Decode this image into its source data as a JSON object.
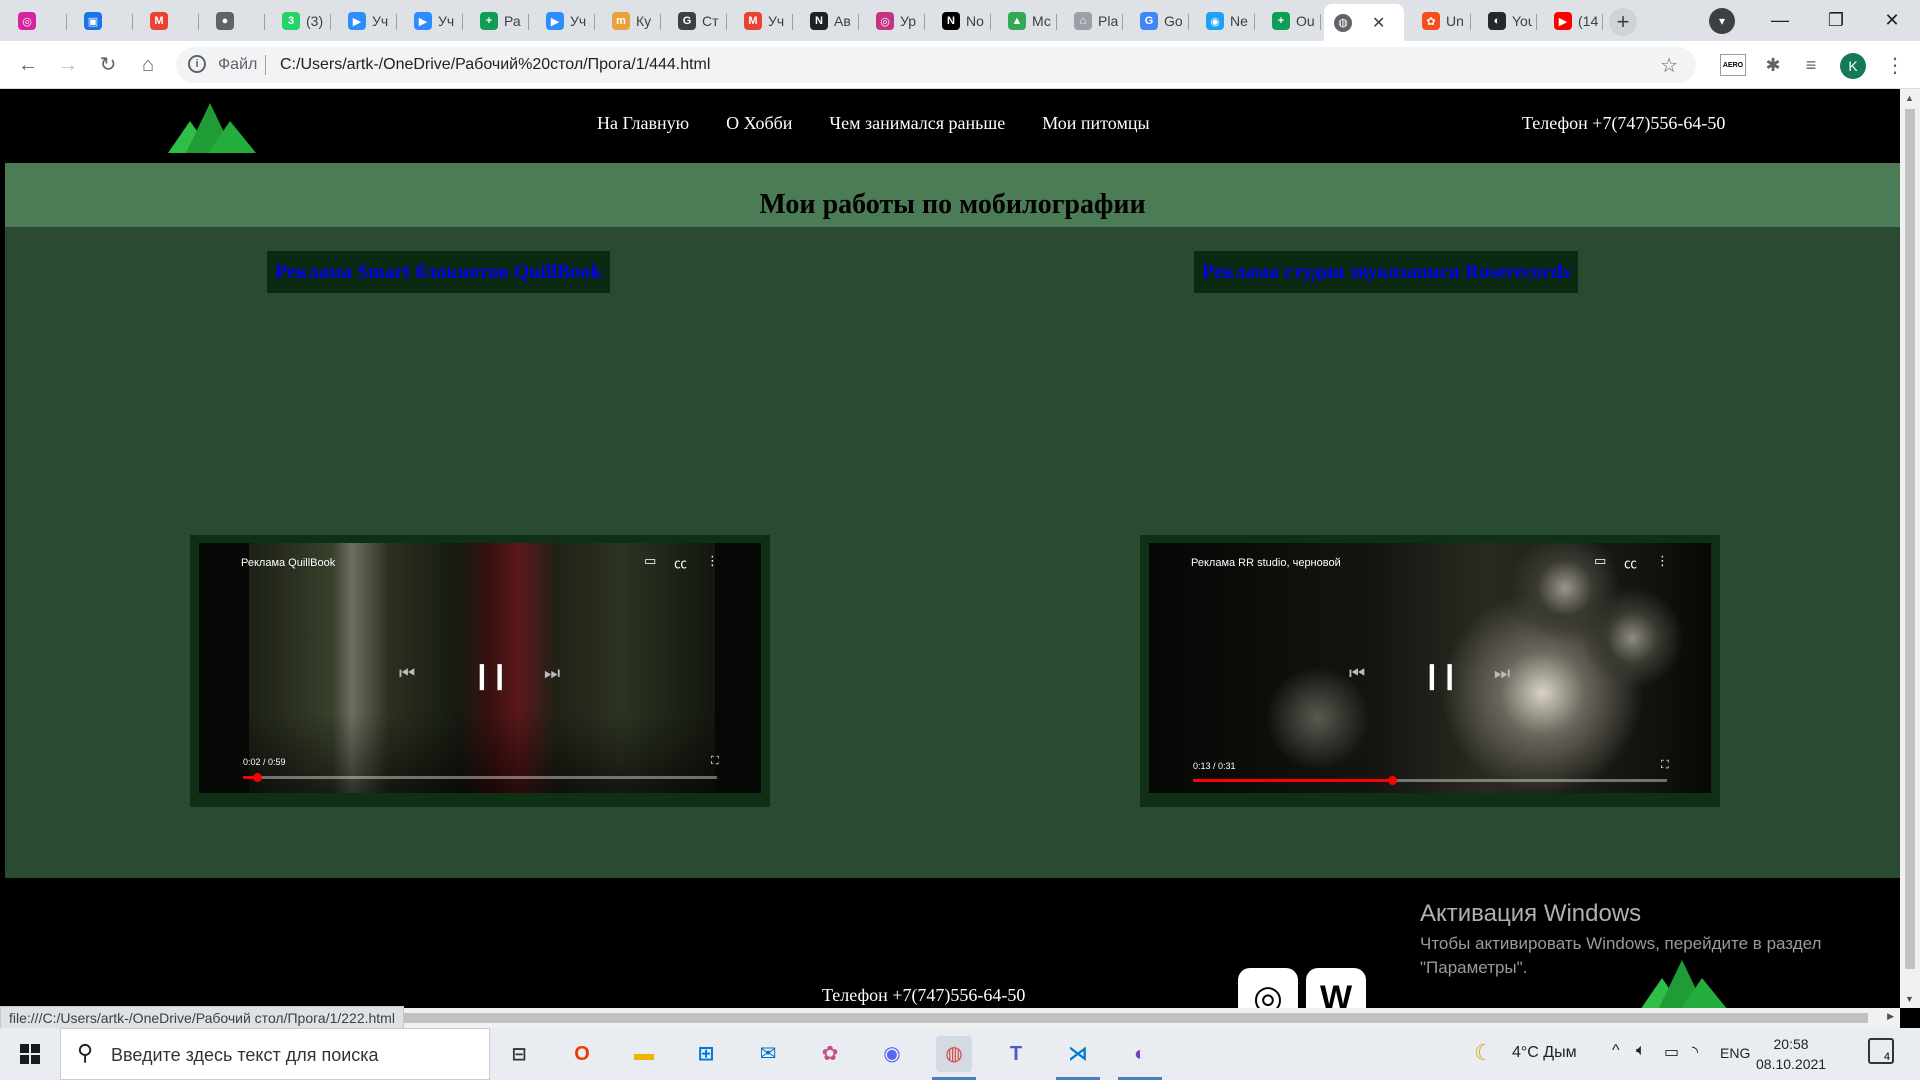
{
  "browser": {
    "tabs": [
      {
        "label": "",
        "color": "#d6249f",
        "glyph": "◎"
      },
      {
        "label": "",
        "color": "#1a73e8",
        "glyph": "▣"
      },
      {
        "label": "",
        "color": "#ea4335",
        "glyph": "M"
      },
      {
        "label": "",
        "color": "#5f6368",
        "glyph": "●"
      },
      {
        "label": "(3)",
        "color": "#25d366",
        "glyph": "3"
      },
      {
        "label": "Уч",
        "color": "#2d8cff",
        "glyph": "▶"
      },
      {
        "label": "Уч",
        "color": "#2d8cff",
        "glyph": "▶"
      },
      {
        "label": "Ра",
        "color": "#0f9d58",
        "glyph": "+"
      },
      {
        "label": "Уч",
        "color": "#2d8cff",
        "glyph": "▶"
      },
      {
        "label": "Ку",
        "color": "#e8a23c",
        "glyph": "m"
      },
      {
        "label": "Ст",
        "color": "#3c4043",
        "glyph": "G"
      },
      {
        "label": "Уч",
        "color": "#ea4335",
        "glyph": "M"
      },
      {
        "label": "Ав",
        "color": "#202124",
        "glyph": "N"
      },
      {
        "label": "Ур",
        "color": "#c13584",
        "glyph": "◎"
      },
      {
        "label": "No",
        "color": "#000000",
        "glyph": "N"
      },
      {
        "label": "Мс",
        "color": "#34a853",
        "glyph": "▲"
      },
      {
        "label": "Pla",
        "color": "#9aa0a6",
        "glyph": "⌂"
      },
      {
        "label": "Go",
        "color": "#4285f4",
        "glyph": "G"
      },
      {
        "label": "Ne",
        "color": "#1da1f2",
        "glyph": "◉"
      },
      {
        "label": "Ou",
        "color": "#0f9d58",
        "glyph": "+"
      }
    ],
    "active_tab_close": "✕",
    "tabs_after": [
      {
        "label": "Un",
        "color": "#f24e1e",
        "glyph": "✿"
      },
      {
        "label": "You",
        "color": "#24292e",
        "glyph": "◐"
      },
      {
        "label": "(14",
        "color": "#ff0000",
        "glyph": "▶"
      }
    ],
    "new_tab": "+",
    "window_minimize": "—",
    "window_restore": "❐",
    "window_close": "✕",
    "address": {
      "scheme_label": "Файл",
      "url": "C:/Users/artk-/OneDrive/Рабочий%20стол/Прога/1/444.html"
    },
    "profile_initial": "K",
    "extension_label": "AERO",
    "status_url": "file:///C:/Users/artk-/OneDrive/Рабочий стол/Прога/1/222.html"
  },
  "site": {
    "nav": [
      "На Главную",
      "О Хобби",
      "Чем занимался раньше",
      "Мои питомцы"
    ],
    "phone": "Телефон +7(747)556-64-50",
    "logo_color": "#1f9c35",
    "main_title": "Мои работы по мобилографии",
    "works": [
      {
        "link": "Реклама Smart блокнотов QuillBook",
        "video_title": "Реклама QuillBook",
        "time": "0:02 / 0:59",
        "progress": 0.03
      },
      {
        "link": "Реклама студии звукозаписи Roserecords",
        "video_title": "Реклама RR studio, черновой",
        "time": "0:13 / 0:31",
        "progress": 0.42
      }
    ],
    "footer_phone": "Телефон +7(747)556-64-50",
    "social": [
      "instagram-icon",
      "vk-icon"
    ]
  },
  "watermark": {
    "title": "Активация Windows",
    "line1": "Чтобы активировать Windows, перейдите в раздел",
    "line2": "\"Параметры\"."
  },
  "taskbar": {
    "search_placeholder": "Введите здесь текст для поиска",
    "weather": "4°C  Дым",
    "language": "ENG",
    "time": "20:58",
    "date": "08.10.2021",
    "notifications": "4"
  }
}
